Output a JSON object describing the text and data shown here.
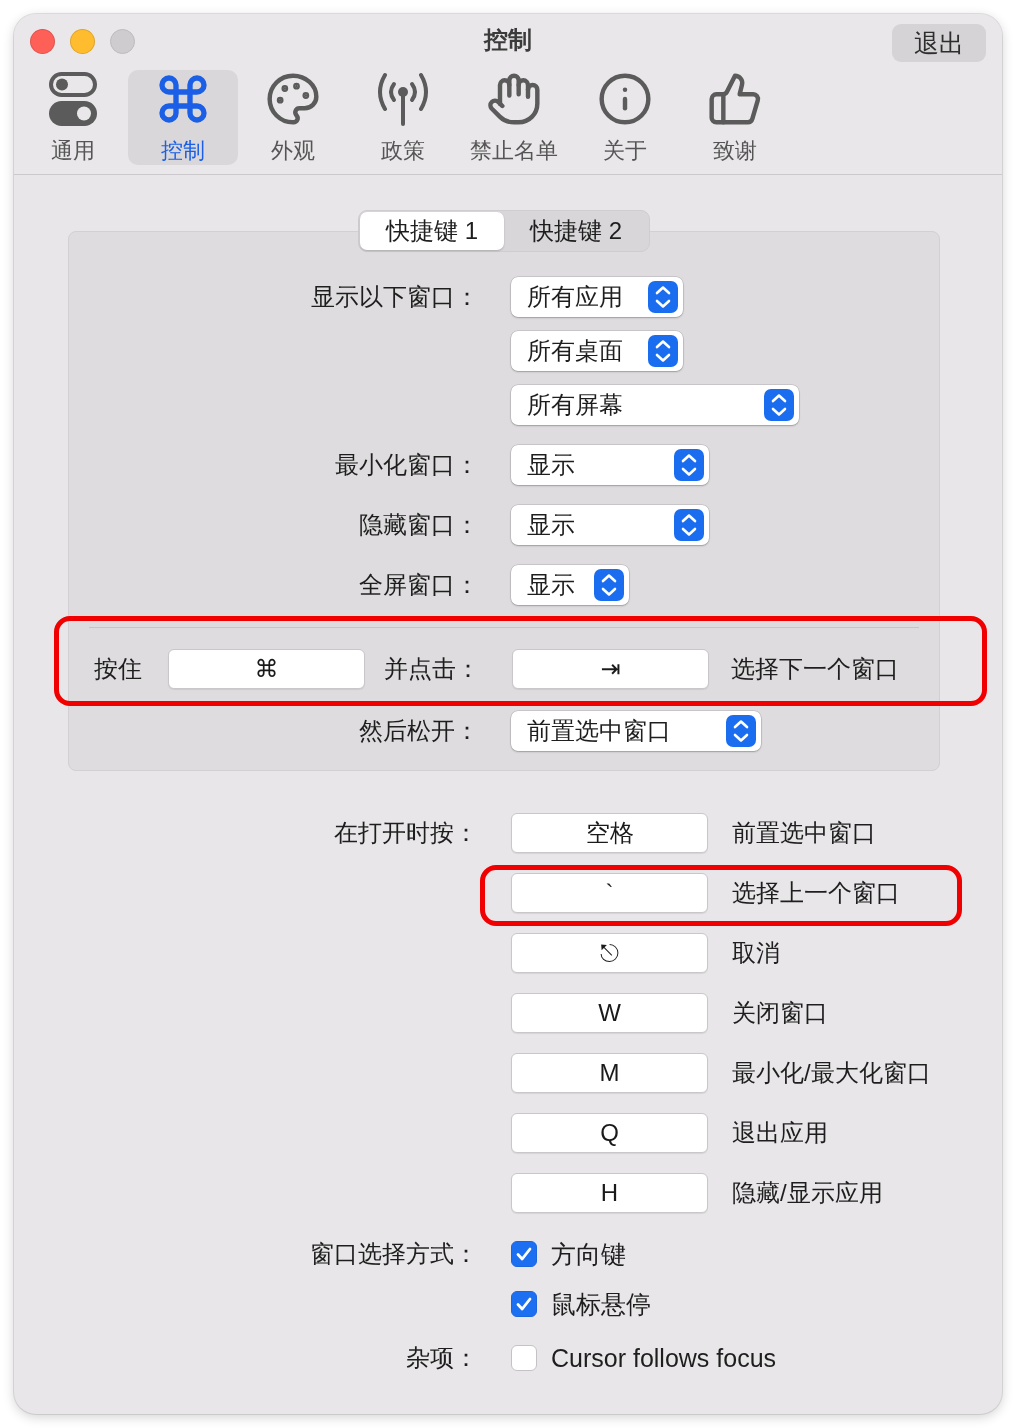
{
  "window": {
    "title": "控制",
    "controls": [
      {
        "kind": "close",
        "disabled": false
      },
      {
        "kind": "minimize",
        "disabled": false
      },
      {
        "kind": "zoom",
        "disabled": true
      }
    ],
    "quit_button": "退出"
  },
  "toolbar": [
    {
      "label": "通用",
      "selected": false
    },
    {
      "label": "控制",
      "selected": true
    },
    {
      "label": "外观",
      "selected": false
    },
    {
      "label": "政策",
      "selected": false
    },
    {
      "label": "禁止名单",
      "selected": false
    },
    {
      "label": "关于",
      "selected": false
    },
    {
      "label": "致谢",
      "selected": false
    }
  ],
  "shortcut_tabs": [
    {
      "label": "快捷键 1",
      "selected": true
    },
    {
      "label": "快捷键 2",
      "selected": false
    }
  ],
  "shortcut_group": {
    "display_rows": [
      {
        "label": "显示以下窗口：",
        "popups": [
          "所有应用",
          "所有桌面",
          "所有屏幕"
        ]
      },
      {
        "label": "最小化窗口：",
        "popups": [
          "显示"
        ]
      },
      {
        "label": "隐藏窗口：",
        "popups": [
          "显示"
        ]
      },
      {
        "label": "全屏窗口：",
        "popups": [
          "显示"
        ]
      }
    ],
    "hold_row": {
      "hold_label": "按住",
      "hold_key": "⌘",
      "click_label": "并点击：",
      "click_key": "⇥",
      "action": "选择下一个窗口",
      "highlighted": true
    },
    "release_row": {
      "label": "然后松开：",
      "popup": "前置选中窗口"
    }
  },
  "open_shortcuts": {
    "label": "在打开时按：",
    "items": [
      {
        "key": "空格",
        "action": "前置选中窗口",
        "highlighted": false
      },
      {
        "key": "`",
        "action": "选择上一个窗口",
        "highlighted": true
      },
      {
        "key": "⎋",
        "action": "取消",
        "highlighted": false
      },
      {
        "key": "W",
        "action": "关闭窗口",
        "highlighted": false
      },
      {
        "key": "M",
        "action": "最小化/最大化窗口",
        "highlighted": false
      },
      {
        "key": "Q",
        "action": "退出应用",
        "highlighted": false
      },
      {
        "key": "H",
        "action": "隐藏/显示应用",
        "highlighted": false
      }
    ]
  },
  "selection": {
    "label": "窗口选择方式：",
    "options": [
      {
        "label": "方向键",
        "checked": true
      },
      {
        "label": "鼠标悬停",
        "checked": true
      }
    ]
  },
  "misc": {
    "label": "杂项：",
    "options": [
      {
        "label": "Cursor follows focus",
        "checked": false
      }
    ]
  }
}
